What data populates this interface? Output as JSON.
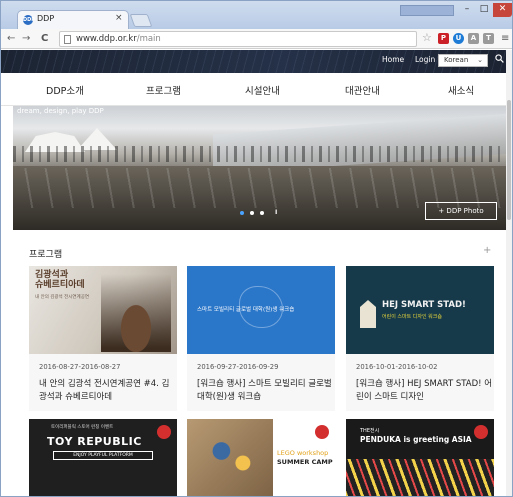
{
  "browser": {
    "tab_title": "DDP",
    "tab_close": "×",
    "favicon_text": "DDP",
    "url_prefix": "www.ddp.or.kr",
    "url_path": "/main",
    "user_badge": "",
    "window_min": "–",
    "window_max": "□",
    "window_close": "✕",
    "back": "←",
    "forward": "→",
    "reload": "C",
    "star": "☆",
    "menu": "≡",
    "extensions": [
      {
        "name": "pinterest-icon",
        "color": "#cb2027",
        "glyph": "P"
      },
      {
        "name": "shield-icon",
        "color": "#1f7cd6",
        "glyph": "U"
      },
      {
        "name": "ext-a-icon",
        "color": "#9a9a9a",
        "glyph": "A"
      },
      {
        "name": "ext-t-icon",
        "color": "#9a9a9a",
        "glyph": "T"
      }
    ]
  },
  "site": {
    "top_links": {
      "home": "Home",
      "login": "Login"
    },
    "language": "Korean",
    "language_caret": "⌄",
    "nav": [
      "DDP소개",
      "프로그램",
      "시설안내",
      "대관안내",
      "새소식"
    ],
    "hero": {
      "caption": "dream, design, play DDP",
      "button": "+ DDP Photo",
      "slide_count": 3,
      "active_slide": 1,
      "pause": "II"
    },
    "section_title": "프로그램",
    "section_more": "+",
    "cards": [
      {
        "date": "2016-08-27-2016-08-27",
        "title": "내 안의 김광석 전시연계공연 #4. 김광석과 슈베르티아데",
        "thumb_title": "김광석과\n슈베르티아데",
        "thumb_sub": "내 안의 김광석 전시연계공연"
      },
      {
        "date": "2016-09-27-2016-09-29",
        "title": "[워크숍 행사] 스마트 모빌리티 글로벌 대학(원)생 워크숍",
        "thumb_title": "스마트 모빌리티 글로벌 대학(원)생 워크숍"
      },
      {
        "date": "2016-10-01-2016-10-02",
        "title": "[워크숍 행사] HEJ SMART STAD! 어린이 스마트 디자인",
        "thumb_title": "HEJ SMART STAD!",
        "thumb_sub": "어린이 스마트 디자인 워크숍"
      }
    ],
    "row2": [
      {
        "thumb_title": "TOY REPUBLIC",
        "thumb_sub": "ENJOY PLAYFUL PLATFORM",
        "thumb_top": "토이리퍼블릭 스토어 런칭 이벤트"
      },
      {
        "thumb_title": "LEGO workshop",
        "thumb_sub": "SUMMER CAMP"
      },
      {
        "thumb_top": "THE전시",
        "thumb_title": "PENDUKA is greeting ASIA"
      }
    ]
  }
}
